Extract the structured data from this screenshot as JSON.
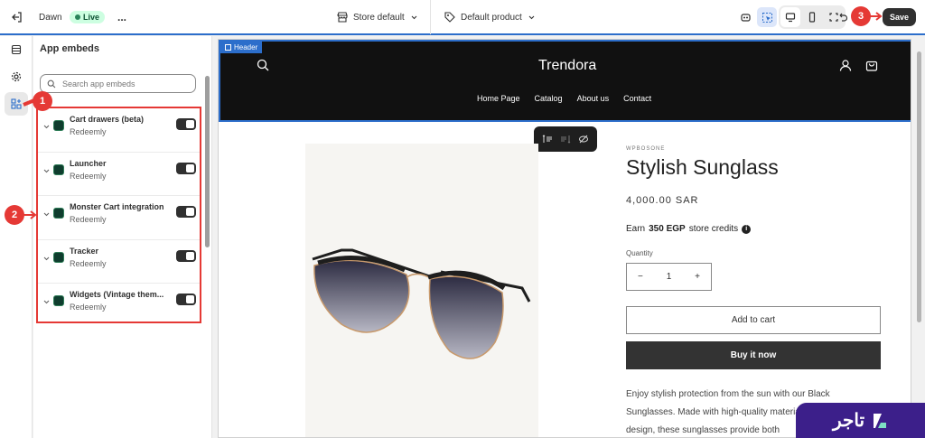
{
  "topbar": {
    "theme_name": "Dawn",
    "live_badge": "Live",
    "more_menu": "...",
    "store_select": "Store default",
    "template_select": "Default product",
    "save_label": "Save"
  },
  "annotations": [
    "1",
    "2",
    "3"
  ],
  "panel": {
    "title": "App embeds",
    "search_placeholder": "Search app embeds",
    "items": [
      {
        "name": "Cart drawers (beta)",
        "app": "Redeemly",
        "enabled": true
      },
      {
        "name": "Launcher",
        "app": "Redeemly",
        "enabled": true
      },
      {
        "name": "Monster Cart integration",
        "app": "Redeemly",
        "enabled": true
      },
      {
        "name": "Tracker",
        "app": "Redeemly",
        "enabled": true
      },
      {
        "name": "Widgets (Vintage them...",
        "app": "Redeemly",
        "enabled": true
      }
    ]
  },
  "preview": {
    "header_tag": "Header",
    "store_name": "Trendora",
    "nav": [
      "Home Page",
      "Catalog",
      "About us",
      "Contact"
    ],
    "vendor": "WPBOSONE",
    "product_title": "Stylish Sunglass",
    "price": "4,000.00 SAR",
    "earn_prefix": "Earn",
    "earn_amount": "350 EGP",
    "earn_suffix": "store credits",
    "quantity_label": "Quantity",
    "quantity_value": "1",
    "add_to_cart": "Add to cart",
    "buy_now": "Buy it now",
    "description": "Enjoy stylish protection from the sun with our Black Sunglasses. Made with high-quality materials and a sleek black design, these sunglasses provide both"
  },
  "watermark": {
    "text": "تاجر"
  },
  "colors": {
    "accent": "#2c6ecb",
    "annotation": "#e53935",
    "live": "#29845a",
    "watermark": "#3c1f8a"
  }
}
